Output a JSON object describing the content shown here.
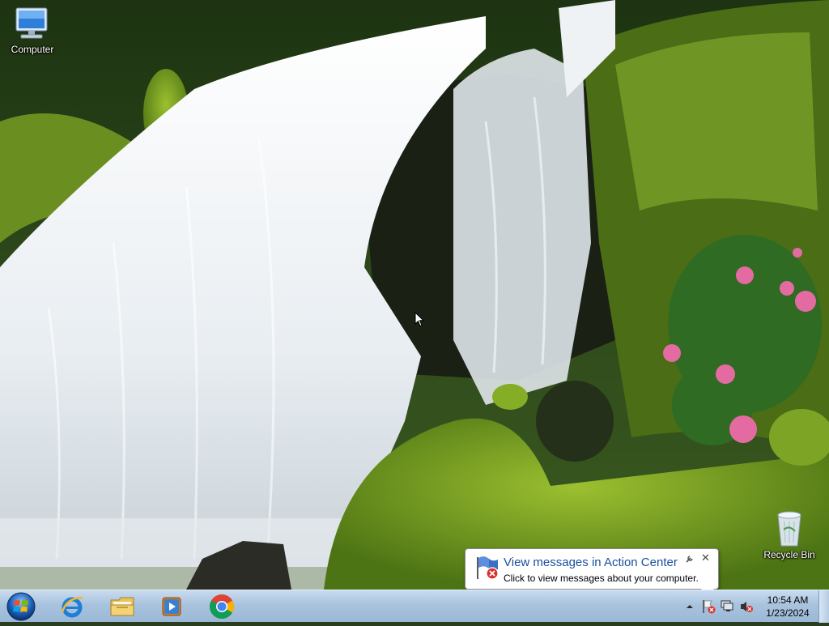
{
  "desktop": {
    "icons": [
      {
        "label": "Computer"
      },
      {
        "label": "Recycle Bin"
      }
    ]
  },
  "taskbar": {
    "start": {
      "icon": "windows-orb-icon"
    },
    "pinned": [
      {
        "icon": "internet-explorer-icon"
      },
      {
        "icon": "file-explorer-icon"
      },
      {
        "icon": "media-player-icon"
      },
      {
        "icon": "chrome-icon"
      }
    ],
    "tray": {
      "icons": [
        "show-hidden-icons",
        "action-center-flag-icon",
        "network-icon",
        "volume-muted-icon"
      ],
      "time": "10:54 AM",
      "date": "1/23/2024"
    }
  },
  "notification": {
    "title": "View messages in Action Center",
    "text": "Click to view messages about your computer."
  }
}
